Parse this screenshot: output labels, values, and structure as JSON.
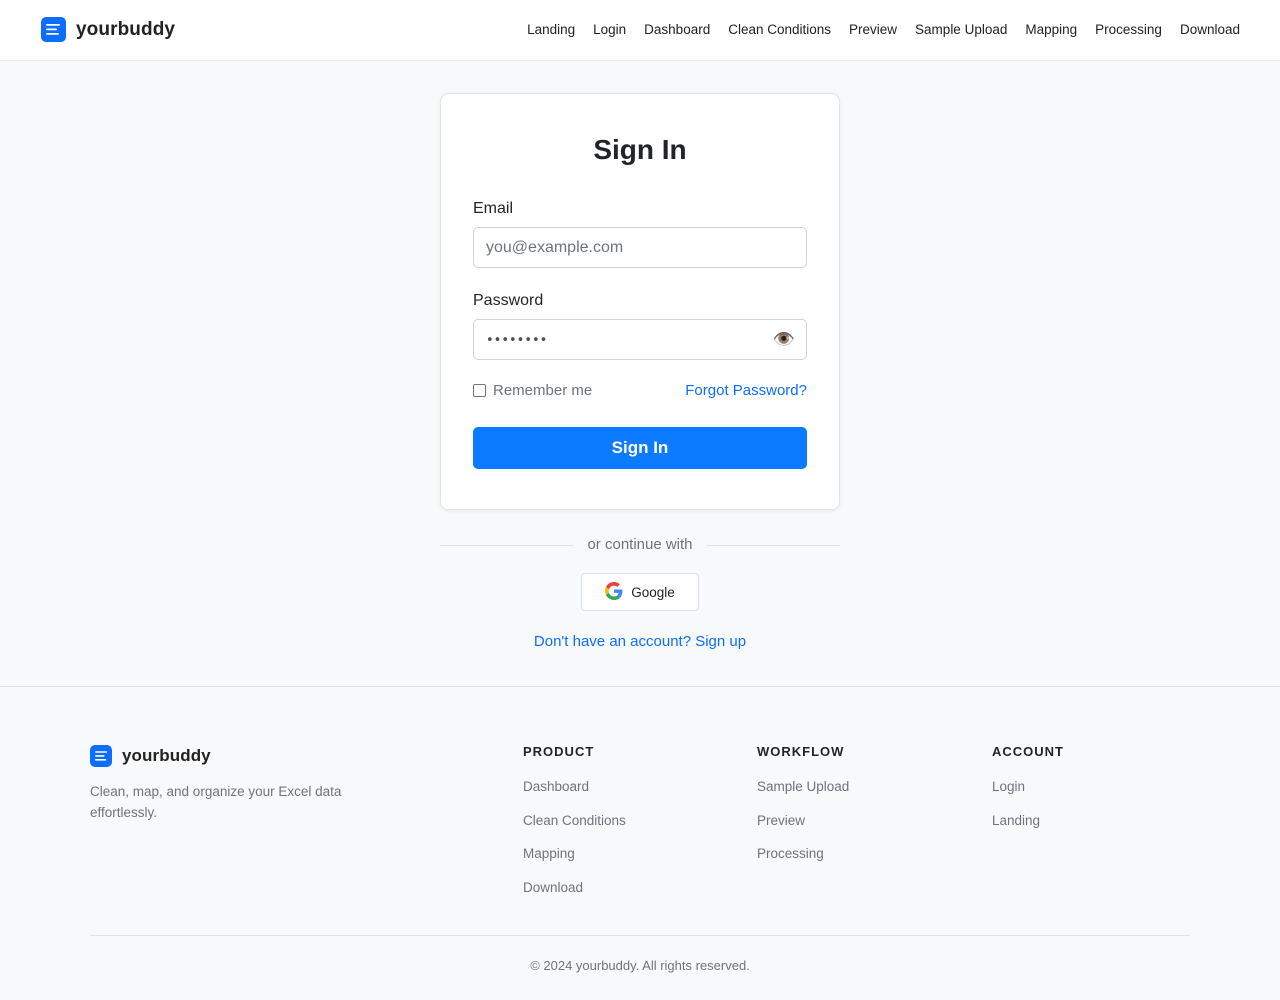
{
  "brand": {
    "name": "yourbuddy",
    "icon": "document-lines-icon",
    "color": "#0d6efd"
  },
  "nav": {
    "items": [
      "Landing",
      "Login",
      "Dashboard",
      "Clean Conditions",
      "Preview",
      "Sample Upload",
      "Mapping",
      "Processing",
      "Download"
    ]
  },
  "signin": {
    "title": "Sign In",
    "email_label": "Email",
    "email_placeholder": "you@example.com",
    "password_label": "Password",
    "password_value": "••••••••",
    "toggle_icon": "eye-icon",
    "remember_label": "Remember me",
    "remember_checked": false,
    "forgot_label": "Forgot Password?",
    "submit_label": "Sign In",
    "accent": "#0d7bff"
  },
  "alt": {
    "divider_text": "or continue with",
    "google_label": "Google",
    "signup_text": "Don't have an account? Sign up"
  },
  "footer": {
    "brand_name": "yourbuddy",
    "tagline": "Clean, map, and organize your Excel data effortlessly.",
    "columns": [
      {
        "title": "PRODUCT",
        "links": [
          "Dashboard",
          "Clean Conditions",
          "Mapping",
          "Download"
        ]
      },
      {
        "title": "WORKFLOW",
        "links": [
          "Sample Upload",
          "Preview",
          "Processing"
        ]
      },
      {
        "title": "ACCOUNT",
        "links": [
          "Login",
          "Landing"
        ]
      }
    ],
    "copyright": "© 2024 yourbuddy. All rights reserved."
  }
}
